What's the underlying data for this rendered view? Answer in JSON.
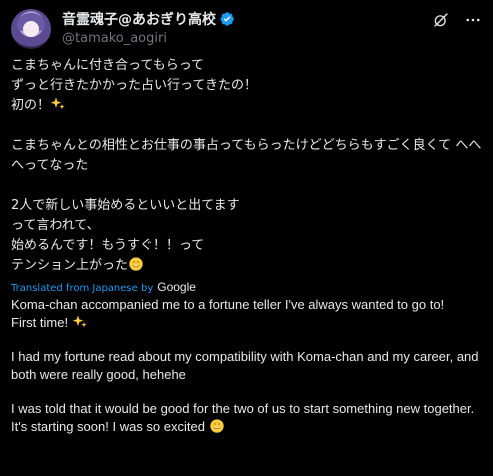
{
  "tweet": {
    "author": {
      "display_name": "音霊魂子@あおぎり高校",
      "handle": "@tamako_aogiri",
      "verified": true
    },
    "icons": {
      "grok": "grok-icon",
      "more": "more-icon",
      "verified": "verified-badge-icon"
    },
    "original": {
      "p1_line1": "こまちゃんに付き合ってもらって",
      "p1_line2": "ずっと行きたかかった占い行ってきたの！",
      "p1_line3": "初の！",
      "p2_line1": "こまちゃんとの相性とお仕事の事占ってもらったけどどちらもすごく良くて へへへってなった",
      "p3_line1": "2人で新しい事始めるといいと出てます",
      "p3_line2": "って言われて、",
      "p3_line3": "始めるんです！もうすぐ！！って",
      "p3_line4": "テンション上がった"
    },
    "translation_label": "Translated from Japanese by",
    "translation_provider": "Google",
    "translated": {
      "p1": "Koma-chan accompanied me to a fortune teller I've always wanted to go to!",
      "p1_line2": "First time!",
      "p2": "I had my fortune read about my compatibility with Koma-chan and my career, and both were really good, hehehe",
      "p3": "I was told that it would be good for the two of us to start something new together.",
      "p3_line2": "It's starting soon! I was so excited"
    },
    "colors": {
      "background": "#000000",
      "text": "#e7e9ea",
      "muted": "#71767b",
      "link": "#1d9bf0",
      "verified": "#1d9bf0"
    }
  }
}
